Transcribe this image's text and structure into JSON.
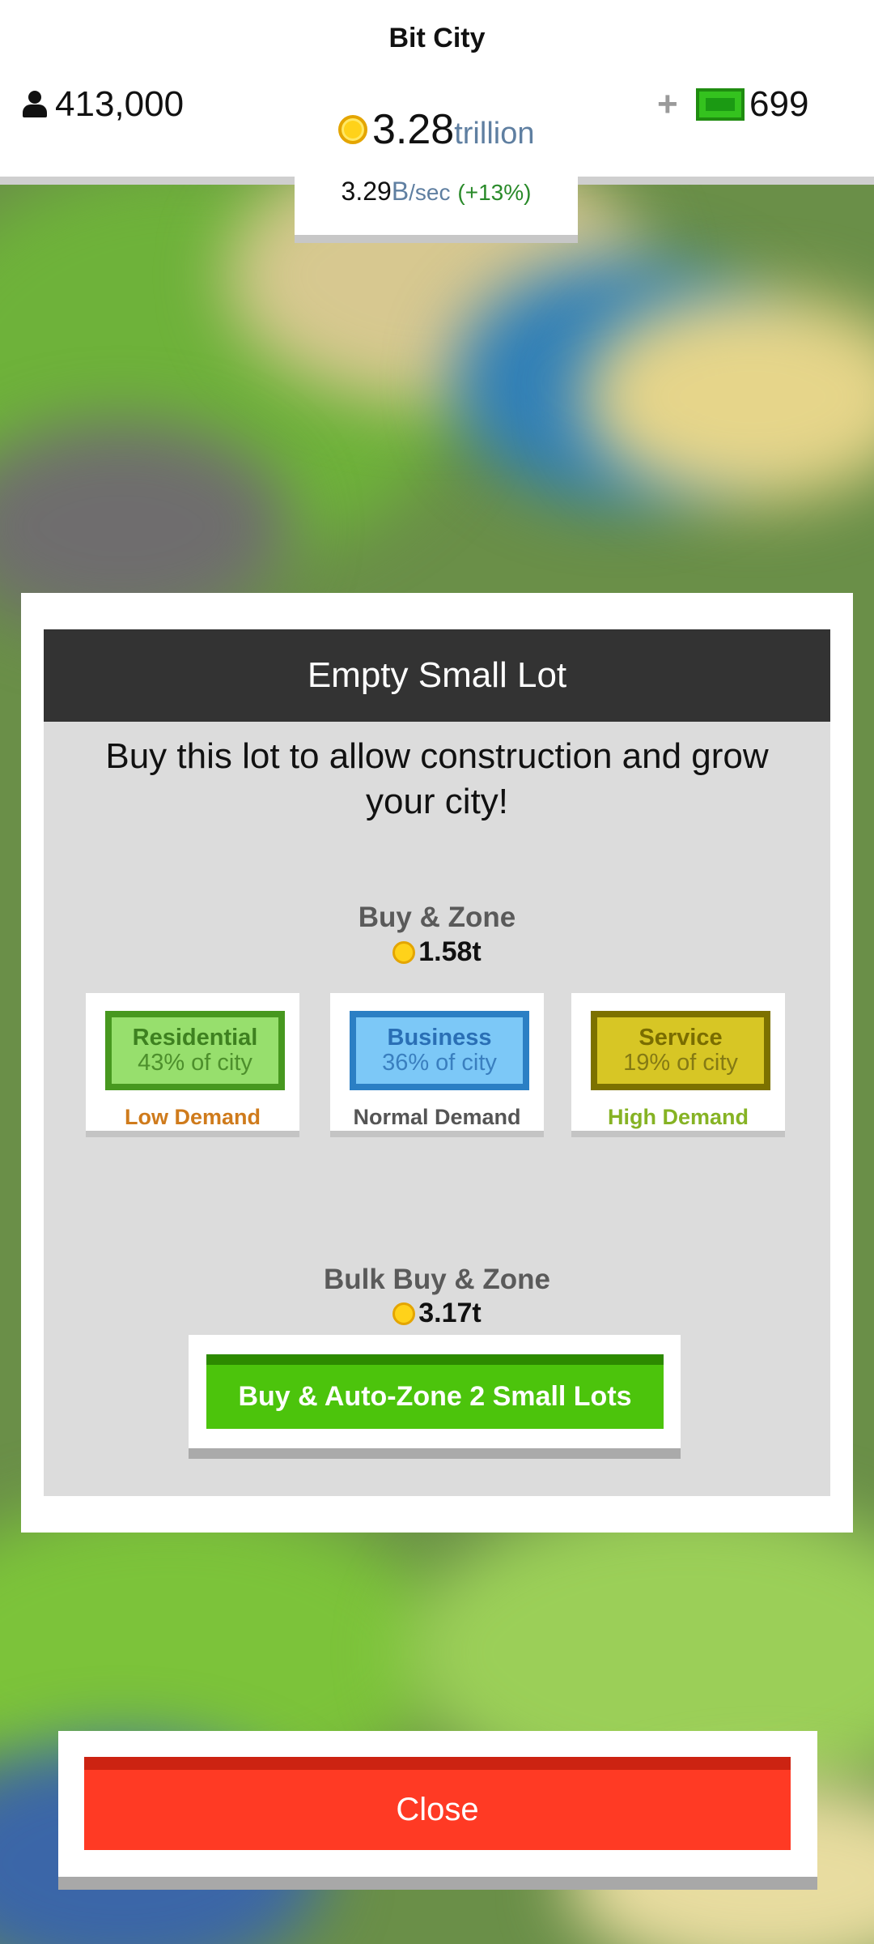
{
  "hud": {
    "city_name": "Bit City",
    "population": "413,000",
    "plus_label": "+",
    "bux": "699",
    "money_value": "3.28",
    "money_unit": "trillion",
    "rate_value": "3.29",
    "rate_unit_big": "B",
    "rate_unit_small": "/sec",
    "rate_pct": "(+13%)"
  },
  "dialog": {
    "title": "Empty Small Lot",
    "description": "Buy this lot to allow construction and grow your city!",
    "buy_zone_label": "Buy & Zone",
    "buy_zone_price": "1.58t",
    "zones": [
      {
        "name": "Residential",
        "pct": "43% of city",
        "demand": "Low Demand"
      },
      {
        "name": "Business",
        "pct": "36% of city",
        "demand": "Normal Demand"
      },
      {
        "name": "Service",
        "pct": "19% of city",
        "demand": "High Demand"
      }
    ],
    "bulk_label": "Bulk Buy & Zone",
    "bulk_price": "3.17t",
    "bulk_button": "Buy & Auto-Zone 2 Small Lots"
  },
  "close_button": "Close",
  "colors": {
    "residential_fill": "#97df6d",
    "residential_border": "#47981f",
    "business_fill": "#7cc8f7",
    "business_border": "#2b7fc4",
    "service_fill": "#d7c625",
    "service_border": "#7c7100",
    "low_demand": "#cf7b1c",
    "normal_demand": "#555555",
    "high_demand": "#86b324",
    "accent_green": "#4cc40c",
    "close_red": "#ff3a24"
  }
}
